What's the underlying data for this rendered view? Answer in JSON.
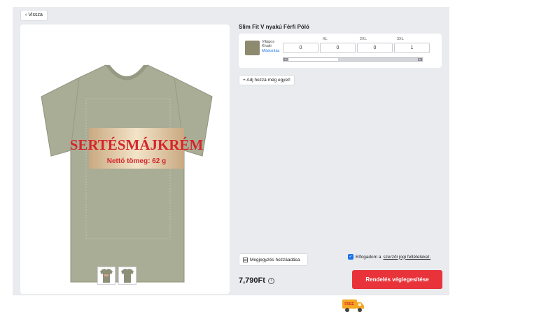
{
  "nav": {
    "back_label": "Vissza",
    "back_icon": "chevron-left-icon"
  },
  "product": {
    "title": "Slim Fit V nyakú Férfi Póló",
    "print_text": "SERTÉSMÁJKRÉM",
    "print_subtext": "Nettó tömeg: 62 g",
    "garment_color": "#a9ad95"
  },
  "variant": {
    "color_name": "Világos Khaki",
    "swatch_color": "#8d8a6f",
    "modify_label": "Módosítás",
    "sizes": [
      {
        "label": "",
        "value": "0"
      },
      {
        "label": "XL",
        "value": "0"
      },
      {
        "label": "2XL",
        "value": "0"
      },
      {
        "label": "3XL",
        "value": "1"
      }
    ]
  },
  "actions": {
    "add_another_label": "+ Adj hozzá még egyet!",
    "note_label": "Megjegyzés hozzáadása",
    "terms_prefix": "Elfogadom a",
    "terms_link": "szerzői jogi feltételeket.",
    "terms_checked": true,
    "finalize_label": "Rendelés véglegesítése"
  },
  "pricing": {
    "price": "7,790Ft"
  },
  "shipping": {
    "badge_text": "FREE"
  },
  "colors": {
    "accent_red": "#e8333a",
    "link_blue": "#1a73e8",
    "panel_bg": "#e9ebef"
  }
}
